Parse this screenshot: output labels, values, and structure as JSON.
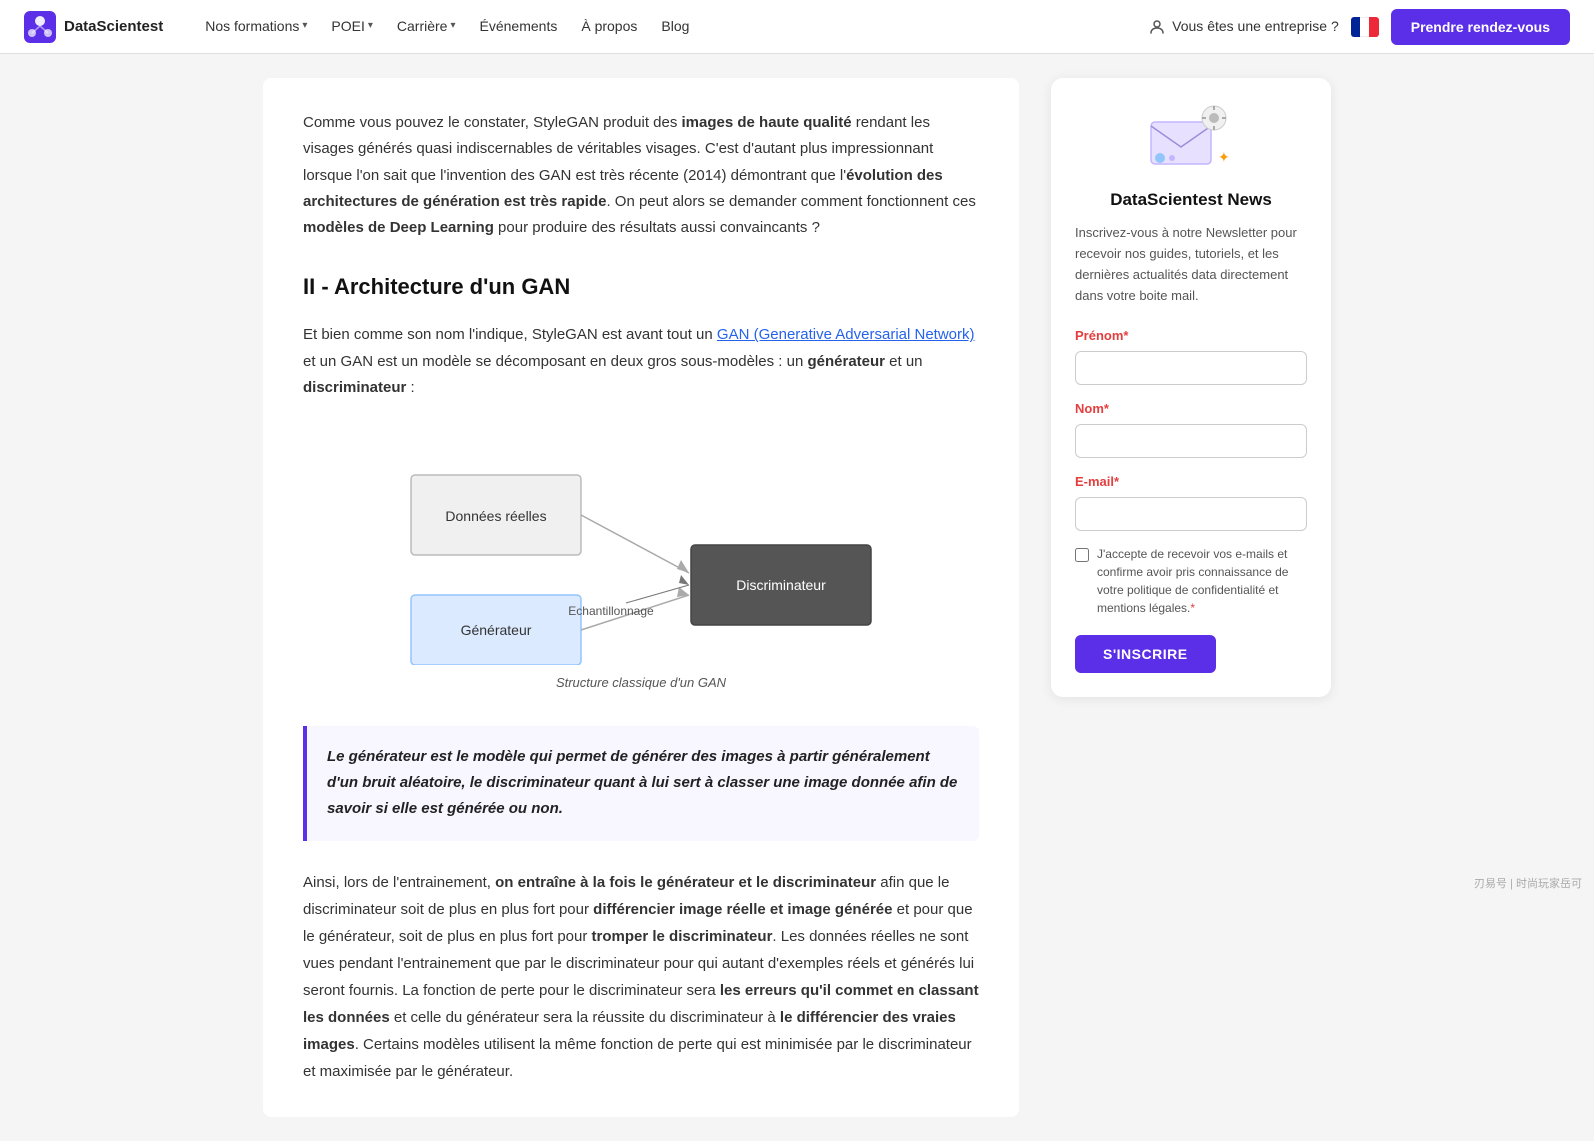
{
  "nav": {
    "logo_text": "DataScientest",
    "links": [
      {
        "label": "Nos formations",
        "has_dropdown": true
      },
      {
        "label": "POEI",
        "has_dropdown": true
      },
      {
        "label": "Carrière",
        "has_dropdown": true
      },
      {
        "label": "Événements",
        "has_dropdown": false
      },
      {
        "label": "À propos",
        "has_dropdown": false
      },
      {
        "label": "Blog",
        "has_dropdown": false
      }
    ],
    "enterprise_label": "Vous êtes une entreprise ?",
    "cta_label": "Prendre rendez-vous"
  },
  "main": {
    "intro_paragraph": "Comme vous pouvez le constater, StyleGAN produit des ",
    "intro_bold1": "images de haute qualité",
    "intro_mid1": " rendant les visages générés quasi indiscernables de véritables visages. C'est d'autant plus impressionnant lorsque l'on sait que l'invention des GAN est très récente (2014) démontrant que l'",
    "intro_bold2": "évolution des architectures de génération est très rapide",
    "intro_mid2": ". On peut alors se demander comment fonctionnent ces ",
    "intro_bold3": "modèles de Deep Learning",
    "intro_end": " pour produire des résultats aussi convaincants ?",
    "section_title": "II - Architecture d'un GAN",
    "section_intro_start": "Et bien comme son nom l'indique, StyleGAN est avant tout un ",
    "section_link_text": "GAN (Generative Adversarial Network)",
    "section_intro_end": " et un GAN est un modèle se décomposant en deux gros sous-modèles : un ",
    "section_bold1": "générateur",
    "section_mid": " et un ",
    "section_bold2": "discriminateur",
    "section_colon": " :",
    "diagram_caption": "Structure classique d'un GAN",
    "diagram": {
      "box_donnees": "Données réelles",
      "box_generateur": "Générateur",
      "box_discriminateur": "Discriminateur",
      "label_echantillonnage": "Echantillonnage"
    },
    "highlight_text": "Le générateur est le modèle qui permet de générer des images à partir généralement d'un bruit aléatoire, le discriminateur quant à lui sert à classer une image donnée afin de savoir si elle est générée ou non.",
    "body_start": "Ainsi, lors de l'entrainement, ",
    "body_bold1": "on entraîne à la fois le générateur et le discriminateur",
    "body_mid1": " afin que le discriminateur soit de plus en plus fort pour ",
    "body_bold2": "différencier image réelle et image générée",
    "body_mid2": " et pour que le générateur, soit de plus en plus fort pour ",
    "body_bold3": "tromper le discriminateur",
    "body_mid3": ". Les données réelles ne sont vues pendant l'entrainement que par le discriminateur pour qui autant d'exemples réels et générés lui seront fournis. La fonction de perte pour le discriminateur sera ",
    "body_bold4": "les erreurs qu'il commet en classant les données",
    "body_mid4": " et celle du générateur sera la réussite du discriminateur à ",
    "body_bold5": "le différencier des vraies images",
    "body_end": ". Certains modèles utilisent la même fonction de perte qui est minimisée par le discriminateur et maximisée par le générateur."
  },
  "sidebar": {
    "title": "DataScientest News",
    "description": "Inscrivez-vous à notre Newsletter pour recevoir nos guides, tutoriels, et les dernières actualités data directement dans votre boite mail.",
    "field_prenom_label": "Prénom",
    "field_prenom_required": "*",
    "field_nom_label": "Nom",
    "field_nom_required": "*",
    "field_email_label": "E-mail",
    "field_email_required": "*",
    "checkbox_label": "J'accepte de recevoir vos e-mails et confirme avoir pris connaissance de votre politique de confidentialité et mentions légales.",
    "checkbox_required": "*",
    "btn_subscribe_label": "S'INSCRIRE"
  },
  "watermark": "刃易号 | 时尚玩家岳可"
}
